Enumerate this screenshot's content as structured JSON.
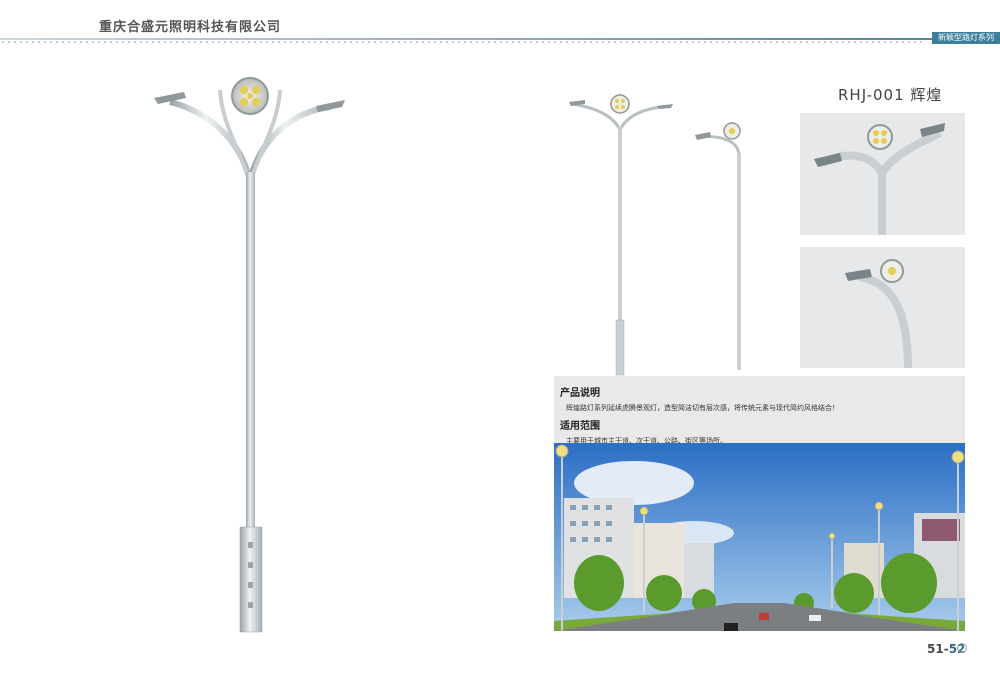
{
  "header": {
    "company": "重庆合盛元照明科技有限公司",
    "series_tag": "新颖型路灯系列"
  },
  "product": {
    "title": "RHJ-001 辉煌"
  },
  "description": {
    "heading": "产品说明",
    "text": "辉煌路灯系列延续虎腾景观灯，造型简洁切有层次感，将传统元素与现代简约风格结合！",
    "scope_heading": "适用范围",
    "scope_text": "主要用于城市主干道、次干道、公路、街区等场所。"
  },
  "footer": {
    "page_a": "51-",
    "page_b": "52"
  },
  "colors": {
    "accent": "#3b7f9b",
    "pole": "#c9cfd3",
    "lamp": "#e8d36a"
  }
}
